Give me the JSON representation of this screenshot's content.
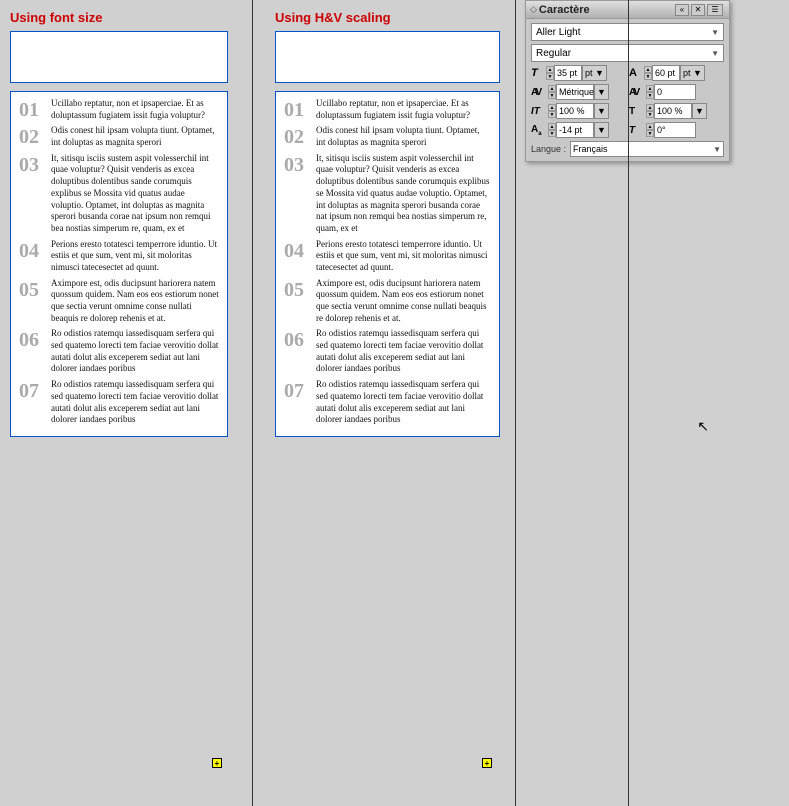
{
  "left_panel": {
    "title": "Using font size",
    "items": [
      {
        "number": "01",
        "text": "Ucillabo reptatur, non et ipsaperciae. Et as doluptassum fugiatem issit fugia voluptur?"
      },
      {
        "number": "02",
        "text": "Odis conest hil ipsam volupta tiunt. Optamet, int doluptas as magnita sperori"
      },
      {
        "number": "03",
        "text": "It, sitisqu isciis sustem aspit volesserchil int quae voluptur? Quisit venderis as excea doluptibus dolentibus sande corumquis explibus se Mossita vid quatus audae voluptio. Optamet, int doluptas as magnita sperori busanda corae nat ipsum non remqui bea nostias simperum re, quam, ex et"
      },
      {
        "number": "04",
        "text": "Perions eresto totatesci temperrore iduntio. Ut estiis et que sum, vent mi, sit moloritas nimusci tatecesectet ad quunt."
      },
      {
        "number": "05",
        "text": "Aximpore est, odis ducipsunt hariorera natem quossum quidem. Nam eos eos estiorum nonet que sectia verunt omnime conse nullati beaquis re dolorep rehenis et at."
      },
      {
        "number": "06",
        "text": "Ro odistios ratemqu iassedisquam serfera qui sed quatemo lorecti tem faciae verovitio dollat autati dolut alis exceperem sediat aut lani dolorer iandaes poribus"
      },
      {
        "number": "07",
        "text": "Ro odistios ratemqu iassedisquam serfera qui sed quatemo lorecti tem faciae verovitio dollat autati dolut alis exceperem sediat aut lani dolorer iandaes poribus"
      }
    ]
  },
  "right_panel": {
    "title": "Using H&V scaling",
    "items": [
      {
        "number": "01",
        "text": "Ucillabo reptatur, non et ipsaperciae. Et as doluptassum fugiatem issit fugia voluptur?"
      },
      {
        "number": "02",
        "text": "Odis conest hil ipsam volupta tiunt. Optamet, int doluptas as magnita sperori"
      },
      {
        "number": "03",
        "text": "It, sitisqu isciis sustem aspit volesserchil int quae voluptur? Quisit venderis as excea doluptibus dolentibus sande corumquis explibus se Mossita vid quatus audae voluptio. Optamet, int doluptas as magnita sperori busanda corae nat ipsum non remqui bea nostias simperum re, quam, ex et"
      },
      {
        "number": "04",
        "text": "Perions eresto totatesci temperrore iduntio. Ut estiis et que sum, vent mi, sit moloritas nimusci tatecesectet ad quunt."
      },
      {
        "number": "05",
        "text": "Aximpore est, odis ducipsunt hariorera natem quossum quidem. Nam eos eos estiorum nonet que sectia verunt omnime conse nullati beaquis re dolorep rehenis et at."
      },
      {
        "number": "06",
        "text": "Ro odistios ratemqu iassedisquam serfera qui sed quatemo lorecti tem faciae verovitio dollat autati dolut alis exceperem sediat aut lani dolorer iandaes poribus"
      },
      {
        "number": "07",
        "text": "Ro odistios ratemqu iassedisquam serfera qui sed quatemo lorecti tem faciae verovitio dollat autati dolut alis exceperem sediat aut lani dolorer iandaes poribus"
      }
    ]
  },
  "caractere": {
    "title": "Caractère",
    "font_name": "Aller Light",
    "font_style": "Regular",
    "font_size": "35 pt",
    "cap_height": "60 pt",
    "kerning_type": "Métrique",
    "kerning_value": "0",
    "h_scale": "100 %",
    "v_scale": "100 %",
    "baseline": "-14 pt",
    "skew": "0°",
    "language_label": "Langue :",
    "language": "Français"
  }
}
